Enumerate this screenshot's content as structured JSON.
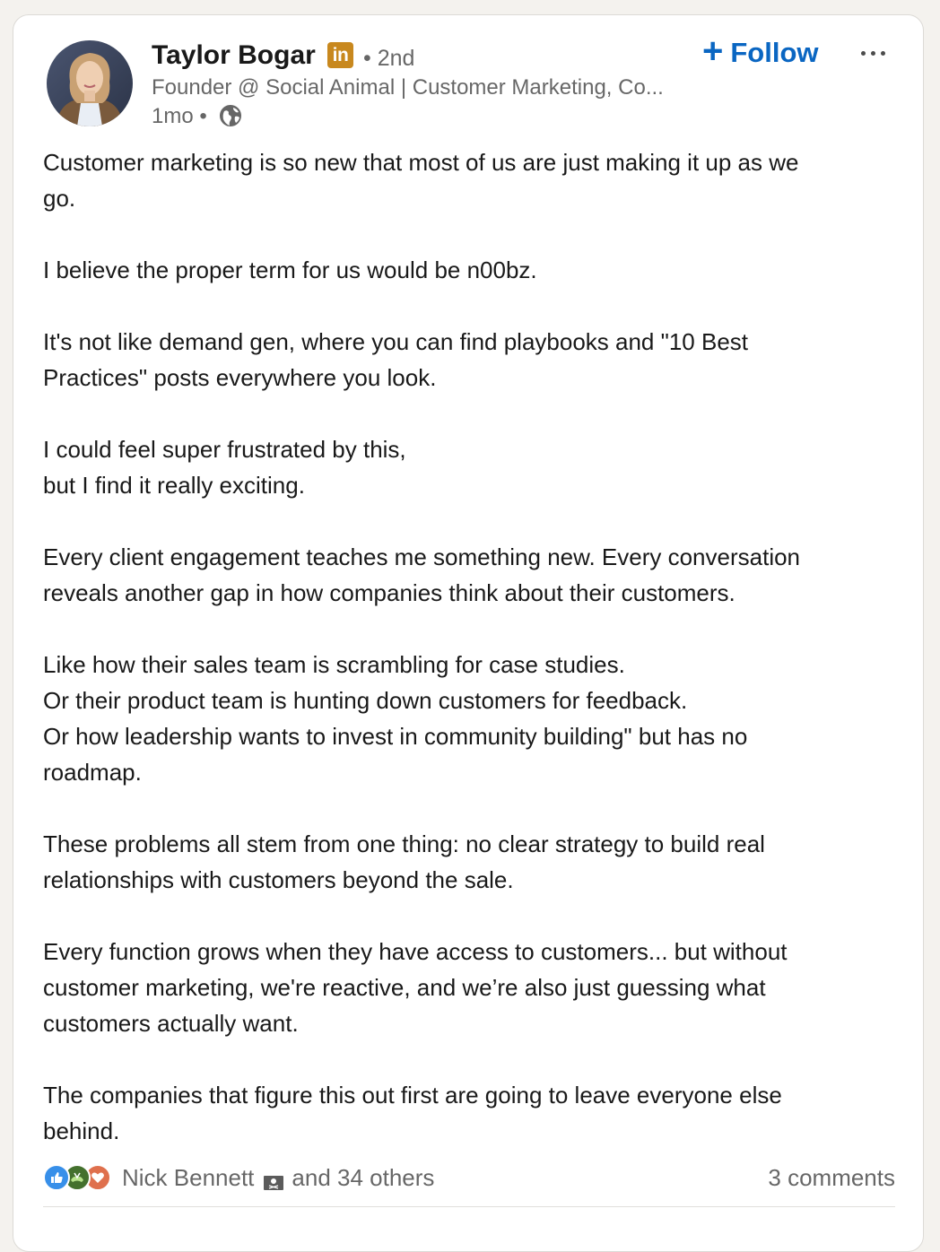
{
  "post": {
    "author": {
      "name": "Taylor Bogar",
      "premium_badge": "in",
      "degree": "• 2nd",
      "headline": "Founder @ Social Animal | Customer Marketing, Co...",
      "time": "1mo •"
    },
    "actions": {
      "follow_label": "Follow",
      "follow_plus": "+",
      "more_icon": "more-horizontal-icon"
    },
    "body": {
      "p1_l1": "Customer marketing is so new that most of us are just making it up as we",
      "p1_l2": "go.",
      "p2_l1": "I believe the proper term for us would be n00bz.",
      "p3_l1": "It's not like demand gen, where you can find playbooks and \"10 Best",
      "p3_l2": "Practices\" posts everywhere you look.",
      "p4_l1": "I could feel super frustrated by this,",
      "p4_l2": "but I find it really exciting.",
      "p5_l1": "Every client engagement teaches me something new. Every conversation",
      "p5_l2": "reveals another gap in how companies think about their customers.",
      "p6_l1": "Like how their sales team is scrambling for case studies.",
      "p6_l2": "Or their product team is hunting down customers for feedback.",
      "p6_l3": "Or how leadership wants to invest in community building\" but has no",
      "p6_l4": "roadmap.",
      "p7_l1": "These problems all stem from one thing: no clear strategy to build real",
      "p7_l2": "relationships with customers beyond the sale.",
      "p8_l1": "Every function grows when they have access to customers... but without",
      "p8_l2": "customer marketing, we're reactive, and we’re also just guessing what",
      "p8_l3": "customers actually want.",
      "p9_l1": "The companies that figure this out first are going to leave everyone else",
      "p9_l2": "behind."
    },
    "social": {
      "reactor": "Nick Bennett",
      "others": "and 34 others",
      "comments": "3 comments"
    }
  },
  "colors": {
    "link_blue": "#0a66c2",
    "premium_gold": "#c8881e",
    "like_blue": "#378fe9",
    "support_green": "#44712e",
    "love_red": "#df704d"
  }
}
